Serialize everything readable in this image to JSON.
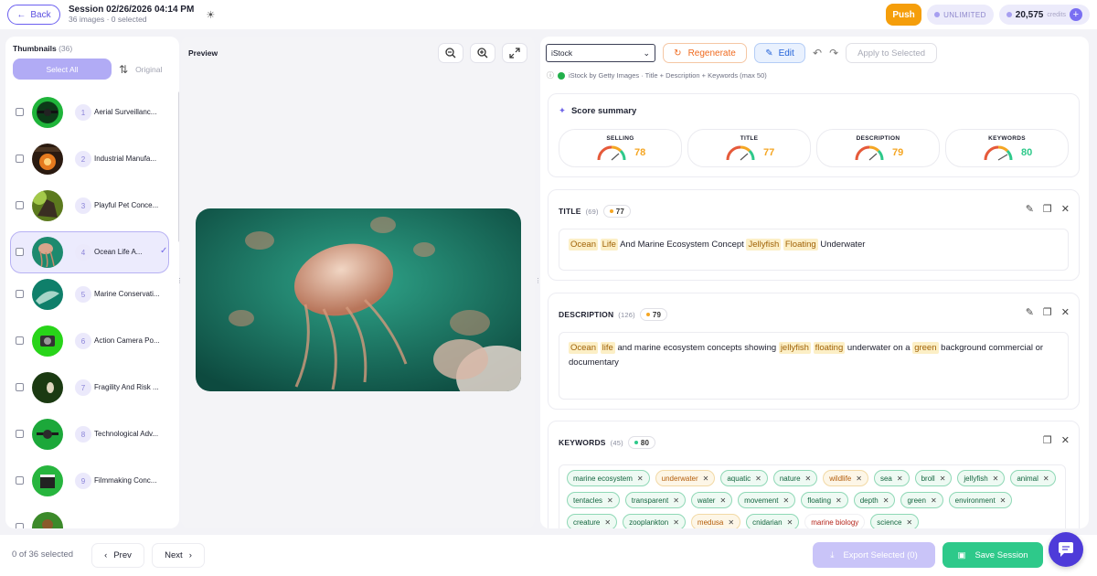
{
  "header": {
    "back_label": "Back",
    "session_title": "Session 02/26/2026 04:14 PM",
    "session_sub": "36 images · 0 selected",
    "push_label": "Push",
    "plan_label": "UNLIMITED",
    "credits_value": "20,575",
    "credits_label": "credits"
  },
  "thumbnails": {
    "title": "Thumbnails",
    "count": "(36)",
    "select_all_label": "Select All",
    "sort_label": "Original",
    "items": [
      {
        "num": "1",
        "label": "Aerial Surveillanc..."
      },
      {
        "num": "2",
        "label": "Industrial Manufa..."
      },
      {
        "num": "3",
        "label": "Playful Pet Conce..."
      },
      {
        "num": "4",
        "label": "Ocean Life A..."
      },
      {
        "num": "5",
        "label": "Marine Conservati..."
      },
      {
        "num": "6",
        "label": "Action Camera Po..."
      },
      {
        "num": "7",
        "label": "Fragility And Risk ..."
      },
      {
        "num": "8",
        "label": "Technological Adv..."
      },
      {
        "num": "9",
        "label": "Filmmaking Conc..."
      }
    ]
  },
  "preview": {
    "title": "Preview"
  },
  "editor": {
    "platform": "iStock",
    "regenerate_label": "Regenerate",
    "edit_label": "Edit",
    "apply_label": "Apply to Selected",
    "provider_text": "iStock by Getty Images · Title + Description + Keywords (max 50)",
    "summary_title": "Score summary",
    "scores": [
      {
        "label": "SELLING",
        "value": "78",
        "color": "#f5a623"
      },
      {
        "label": "TITLE",
        "value": "77",
        "color": "#f5a623"
      },
      {
        "label": "DESCRIPTION",
        "value": "79",
        "color": "#f5a623"
      },
      {
        "label": "KEYWORDS",
        "value": "80",
        "color": "#2ec98a"
      }
    ],
    "title_section": {
      "label": "TITLE",
      "count": "(69)",
      "score": "77",
      "words": [
        "Ocean",
        "Life",
        "And Marine Ecosystem Concept",
        "Jellyfish",
        "Floating",
        "Underwater"
      ]
    },
    "description_section": {
      "label": "DESCRIPTION",
      "count": "(126)",
      "score": "79",
      "words": [
        "Ocean",
        "life",
        "and marine ecosystem concepts showing",
        "jellyfish",
        "floating",
        "underwater on a",
        "green",
        "background commercial or documentary"
      ]
    },
    "keywords_section": {
      "label": "KEYWORDS",
      "count": "(45)",
      "score": "80",
      "keywords": [
        "marine ecosystem",
        "underwater",
        "aquatic",
        "nature",
        "wildlife",
        "sea",
        "broll",
        "jellyfish",
        "animal",
        "tentacles",
        "transparent",
        "water",
        "movement",
        "floating",
        "depth",
        "green",
        "environment",
        "creature",
        "zooplankton",
        "medusa",
        "cnidarian",
        "marine biology",
        "science"
      ]
    }
  },
  "footer": {
    "selected_count": "0 of 36 selected",
    "prev_label": "Prev",
    "next_label": "Next",
    "export_label": "Export Selected (0)",
    "save_label": "Save Session"
  }
}
